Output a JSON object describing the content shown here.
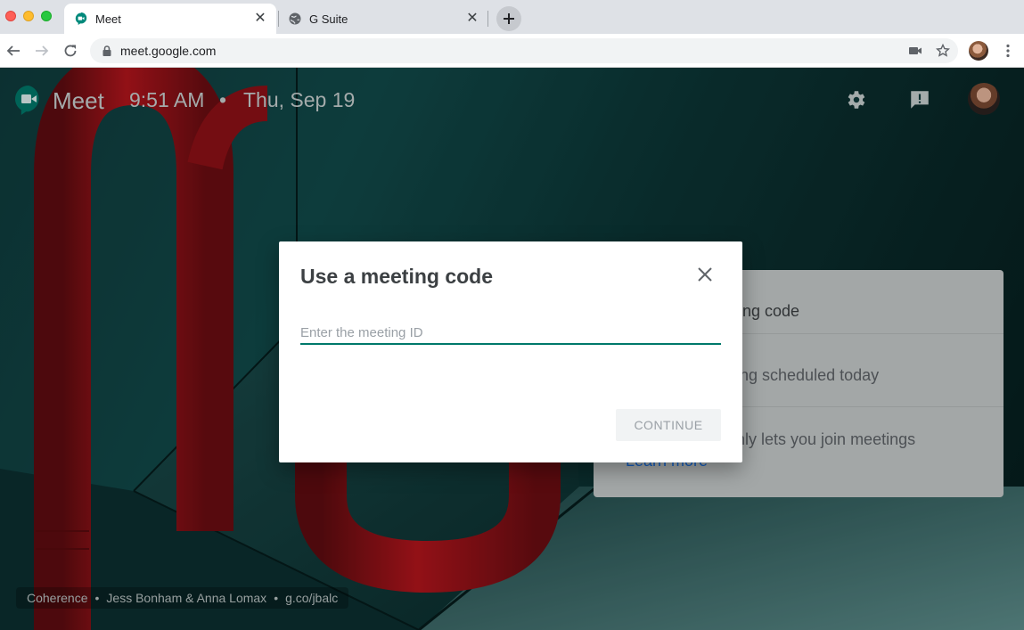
{
  "browser": {
    "tabs": [
      {
        "title": "Meet",
        "favicon": "meet-icon",
        "active": true
      },
      {
        "title": "G Suite",
        "favicon": "globe-icon",
        "active": false
      }
    ],
    "url": "meet.google.com"
  },
  "header": {
    "brand": "Meet",
    "time": "9:51 AM",
    "separator": "•",
    "date": "Thu, Sep 19"
  },
  "background_card": {
    "rows": [
      "eting code",
      "ing scheduled today",
      "nly lets you join meetings"
    ],
    "link": "Learn more"
  },
  "credit": {
    "title": "Coherence",
    "artists": "Jess Bonham & Anna Lomax",
    "link": "g.co/jbalc",
    "separator": "•"
  },
  "dialog": {
    "title": "Use a meeting code",
    "input_value": "",
    "input_placeholder": "Enter the meeting ID",
    "continue_label": "CONTINUE"
  },
  "colors": {
    "accent": "#00796b",
    "page_bg": "#0f3b3c",
    "sculpture_red": "#a8121a"
  }
}
